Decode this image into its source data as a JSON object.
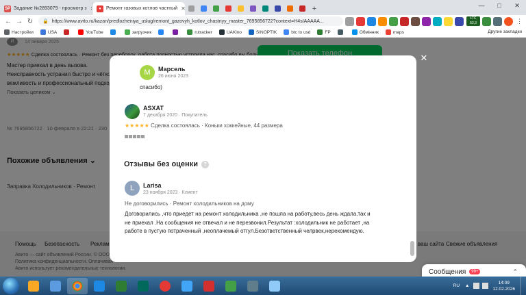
{
  "browser": {
    "tabs": [
      {
        "label": "Задание №2893079 - просмотр з",
        "icon": "sp",
        "color": "#d9534f"
      },
      {
        "label": "Ремонт газовых котлов частный",
        "icon": "avito",
        "color": "#e53935"
      }
    ],
    "new_tab_label": "+",
    "url": "https://www.avito.ru/kazan/predlozheniya_uslug/remont_gazovyh_kotlov_chastnyy_master_7695856722?context=H4sIAAAAA...",
    "ext_ltc_label": "LTC",
    "ext_ltc_value": "53,3"
  },
  "bookmarks": [
    {
      "label": "Настройки",
      "color": "#5f6368"
    },
    {
      "label": "USA",
      "color": "#3c78d8"
    },
    {
      "label": "",
      "color": "#c62828"
    },
    {
      "label": "YouTube",
      "color": "#ff0000"
    },
    {
      "label": "",
      "color": "#1e88e5"
    },
    {
      "label": "загрузчик",
      "color": "#4caf50"
    },
    {
      "label": "",
      "color": "#2787f5"
    },
    {
      "label": "",
      "color": "#7b1fa2"
    },
    {
      "label": "rutracker",
      "color": "#388e3c"
    },
    {
      "label": "UAKino",
      "color": "#263238"
    },
    {
      "label": "SINOPTIK",
      "color": "#1565c0"
    },
    {
      "label": "btc to usd",
      "color": "#4285f4"
    },
    {
      "label": "FP",
      "color": "#2e7d32"
    },
    {
      "label": "",
      "color": "#455a64"
    },
    {
      "label": "Обмінник",
      "color": "#0091ea"
    },
    {
      "label": "maps",
      "color": "#ea4335"
    }
  ],
  "bookmarks_other": "Другие закладки",
  "page": {
    "bg_reviewer": "И",
    "bg_review_date": "14 января 2025",
    "bg_review_meta": "Сделка состоялась · Ремонт без переборок, работа полностью устроила нас. спасибо вы большое",
    "bg_line1": "Мастер приехал в день вызова.",
    "bg_line2": "Неисправность устранил быстро и чётко",
    "bg_line3": "вежливость и профессиональный подход",
    "bg_show_all": "Показать целиком",
    "bg_listing_meta": "№ 7695856722 · 10 февраля в 22:21 · 230",
    "bg_similar": "Похожие объявления",
    "bg_similar_item": "Заправка Холодильников · Ремонт",
    "show_phone": "Показать телефон",
    "footer_links": [
      "Помощь",
      "Безопасность",
      "Реклама"
    ],
    "footer_right": [
      "ваш сайта",
      "Свежие объявления"
    ],
    "footer_l1": "Авито — сайт объявлений России. © ООО",
    "footer_l2": "Политика конфиденциальности. Оплачивая",
    "footer_l3": "Авито использует рекомендательные технологии."
  },
  "modal": {
    "close_label": "✕",
    "review1": {
      "initial": "М",
      "name": "Марсель",
      "date": "26 июня 2023",
      "text": "спасибо)"
    },
    "review2": {
      "name": "ASXAT",
      "meta": "7 декабря 2020 · Покупатель",
      "stars": "★★★★★",
      "deal": "Сделка состоялась · Коньки хоккейные, 44 размера"
    },
    "section_title": "Отзывы без оценки",
    "section_help": "?",
    "review3": {
      "initial": "L",
      "name": "Larisa",
      "meta": "23 ноября 2023 · Клиент",
      "deal": "Не договорились · Ремонт холодильников на дому",
      "line1": "Договорились ,что приедет на ремонт холодильника ,не пошла на работу,весь день ждала,так и",
      "line2": "не приехал .На сообщения не отвечал и не перезвонил.Результат :холодильник не работает ,на",
      "line3": "работе в пустую потраченный ,неоплачемый отгул.Безответственный челрвек,нерекомендую."
    }
  },
  "messages": {
    "label": "Сообщения",
    "badge": "99+"
  },
  "taskbar": {
    "lang": "RU",
    "time": "14:09",
    "date": "12.02.2026"
  }
}
